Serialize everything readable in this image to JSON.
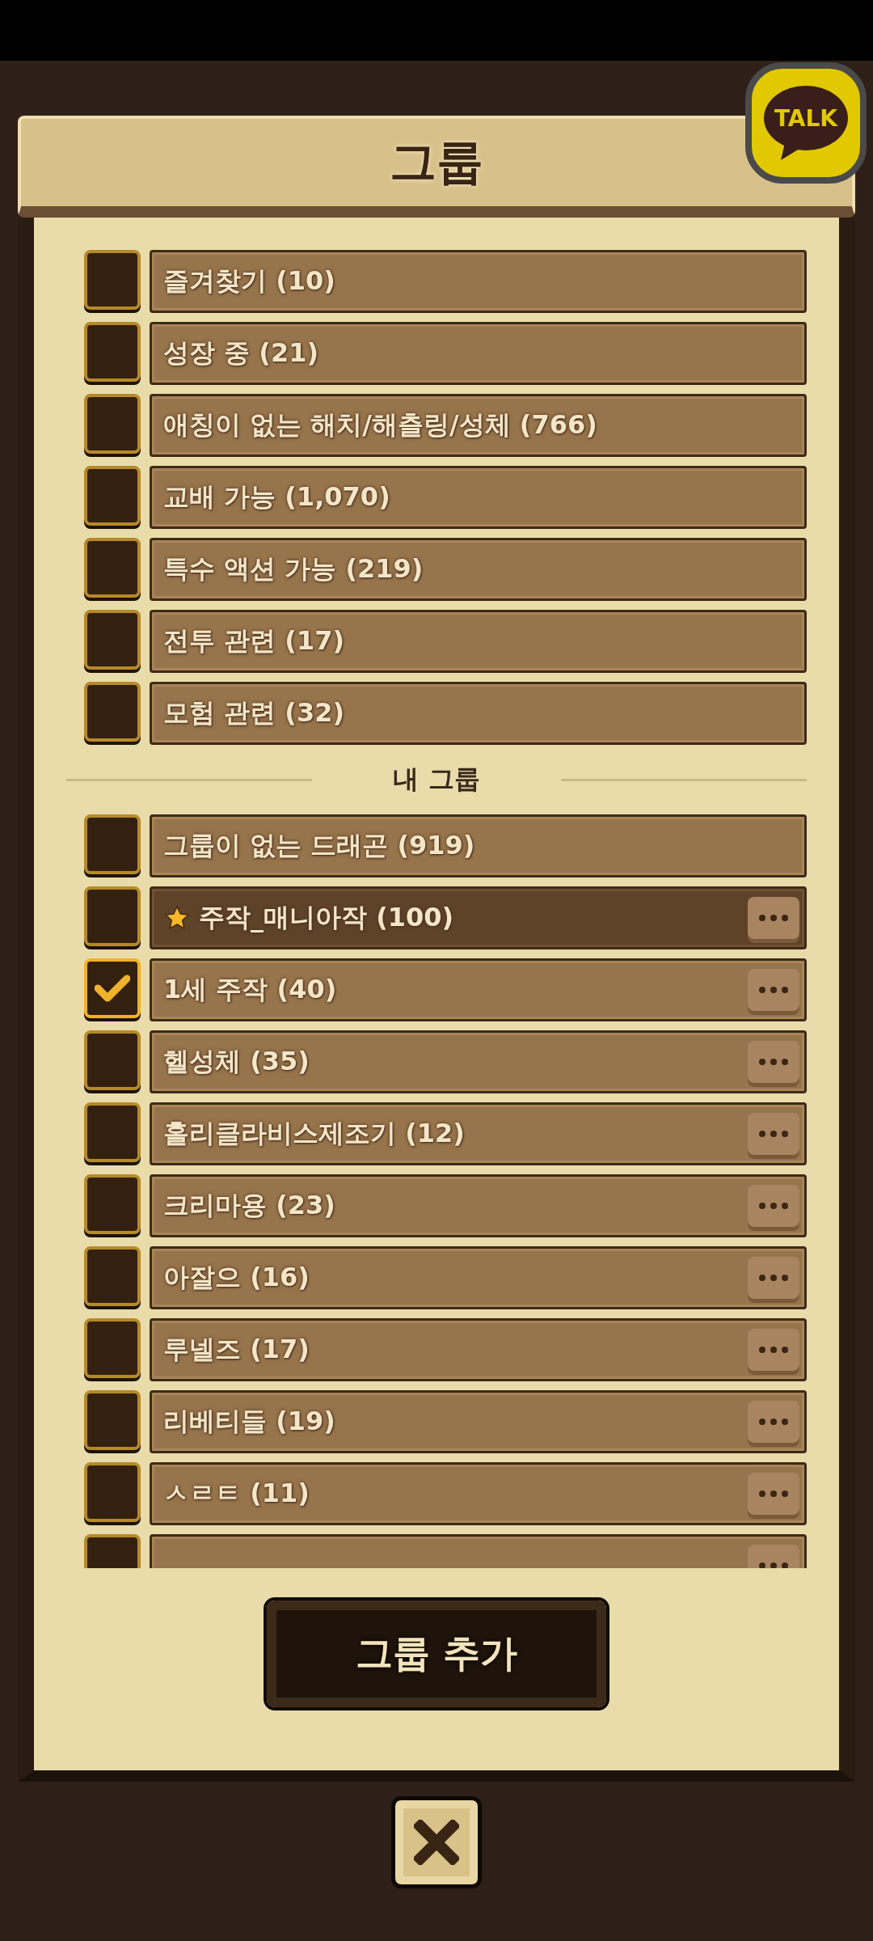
{
  "title": "그룹",
  "talk_badge": "TALK",
  "default_groups": [
    {
      "label": "즐겨찾기 (10)",
      "checked": false
    },
    {
      "label": "성장 중 (21)",
      "checked": false
    },
    {
      "label": "애칭이 없는 해치/해츨링/성체 (766)",
      "checked": false
    },
    {
      "label": "교배 가능 (1,070)",
      "checked": false
    },
    {
      "label": "특수 액션 가능 (219)",
      "checked": false
    },
    {
      "label": "전투 관련 (17)",
      "checked": false
    },
    {
      "label": "모험 관련 (32)",
      "checked": false
    }
  ],
  "my_groups_heading": "내 그룹",
  "my_groups": [
    {
      "label": "그룹이 없는 드래곤 (919)",
      "checked": false,
      "starred": false,
      "has_menu": false
    },
    {
      "label": "주작_매니아작 (100)",
      "checked": false,
      "starred": true,
      "has_menu": true
    },
    {
      "label": "1세 주작 (40)",
      "checked": true,
      "starred": false,
      "has_menu": true
    },
    {
      "label": "헬성체 (35)",
      "checked": false,
      "starred": false,
      "has_menu": true
    },
    {
      "label": "홀리클라비스제조기 (12)",
      "checked": false,
      "starred": false,
      "has_menu": true
    },
    {
      "label": "크리마용 (23)",
      "checked": false,
      "starred": false,
      "has_menu": true
    },
    {
      "label": "아잘으 (16)",
      "checked": false,
      "starred": false,
      "has_menu": true
    },
    {
      "label": "루넬즈 (17)",
      "checked": false,
      "starred": false,
      "has_menu": true
    },
    {
      "label": "리베티들 (19)",
      "checked": false,
      "starred": false,
      "has_menu": true
    },
    {
      "label": "ㅅㄹㅌ (11)",
      "checked": false,
      "starred": false,
      "has_menu": true
    },
    {
      "checked": false,
      "starred": false,
      "has_menu": true
    }
  ],
  "add_button": "그룹 추가"
}
